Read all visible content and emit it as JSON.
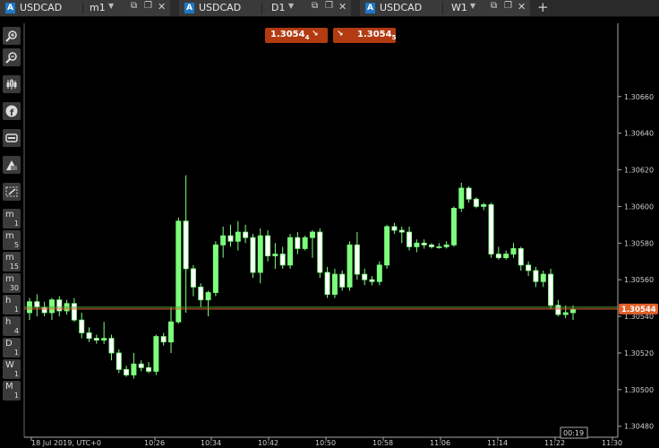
{
  "tabs": [
    {
      "badge": "A",
      "symbol": "USDCAD",
      "timeframe": "m1"
    },
    {
      "badge": "A",
      "symbol": "USDCAD",
      "timeframe": "D1"
    },
    {
      "badge": "A",
      "symbol": "USDCAD",
      "timeframe": "W1"
    }
  ],
  "new_tab_label": "+",
  "toolbar_buttons": [
    "zoom-in-icon",
    "zoom-out-icon",
    "indicators-icon",
    "facebook-icon",
    "gamepad-icon",
    "drawing-icon",
    "screenshot-icon"
  ],
  "timeframes": [
    {
      "unit": "m",
      "num": "1"
    },
    {
      "unit": "m",
      "num": "5"
    },
    {
      "unit": "m",
      "num": "15"
    },
    {
      "unit": "m",
      "num": "30"
    },
    {
      "unit": "h",
      "num": "1"
    },
    {
      "unit": "h",
      "num": "4"
    },
    {
      "unit": "D",
      "num": "1"
    },
    {
      "unit": "W",
      "num": "1"
    },
    {
      "unit": "M",
      "num": "1"
    }
  ],
  "bid": {
    "price": "1.3054",
    "pip": "4"
  },
  "ask": {
    "price": "1.3054",
    "pip": "5"
  },
  "current_price": "1.30544",
  "countdown": "00:19",
  "colors": {
    "bull": "#7dff7d",
    "bear": "#ffffff",
    "price_line": "#e0602a",
    "accent": "#b23b12"
  },
  "chart_data": {
    "type": "candlestick",
    "instrument": "USDCAD",
    "timeframe": "m1",
    "y_ticks": [
      "1.30660",
      "1.30640",
      "1.30620",
      "1.30600",
      "1.30580",
      "1.30560",
      "1.30540",
      "1.30520",
      "1.30500",
      "1.30480"
    ],
    "x_ticks": [
      "18 Jul 2019, UTC+0",
      "10:26",
      "10:34",
      "10:42",
      "10:50",
      "10:58",
      "11:06",
      "11:14",
      "11:22",
      "11:30"
    ],
    "ylim": [
      1.30474,
      1.307
    ],
    "candles": [
      [
        1.30542,
        1.3055,
        1.30538,
        1.30548
      ],
      [
        1.30548,
        1.30552,
        1.3054,
        1.30545
      ],
      [
        1.30545,
        1.30548,
        1.3054,
        1.30542
      ],
      [
        1.30542,
        1.3055,
        1.30538,
        1.30549
      ],
      [
        1.30549,
        1.30551,
        1.3054,
        1.30543
      ],
      [
        1.30543,
        1.30549,
        1.30541,
        1.30547
      ],
      [
        1.30547,
        1.3055,
        1.30537,
        1.30538
      ],
      [
        1.30538,
        1.30542,
        1.30528,
        1.30531
      ],
      [
        1.30531,
        1.30534,
        1.30526,
        1.30528
      ],
      [
        1.30528,
        1.3053,
        1.30525,
        1.30527
      ],
      [
        1.30527,
        1.30537,
        1.30525,
        1.30528
      ],
      [
        1.30528,
        1.3053,
        1.30516,
        1.3052
      ],
      [
        1.3052,
        1.30522,
        1.30509,
        1.30511
      ],
      [
        1.30511,
        1.30513,
        1.30507,
        1.30508
      ],
      [
        1.30508,
        1.3052,
        1.30506,
        1.30514
      ],
      [
        1.30514,
        1.30516,
        1.3051,
        1.30512
      ],
      [
        1.30512,
        1.30515,
        1.30509,
        1.3051
      ],
      [
        1.3051,
        1.3053,
        1.30508,
        1.30529
      ],
      [
        1.30529,
        1.30531,
        1.30524,
        1.30526
      ],
      [
        1.30526,
        1.30545,
        1.3052,
        1.30537
      ],
      [
        1.30537,
        1.30594,
        1.30536,
        1.30592
      ],
      [
        1.30592,
        1.30617,
        1.30542,
        1.30566
      ],
      [
        1.30566,
        1.30568,
        1.30551,
        1.30556
      ],
      [
        1.30556,
        1.30558,
        1.30545,
        1.30549
      ],
      [
        1.30549,
        1.30554,
        1.3054,
        1.30553
      ],
      [
        1.30553,
        1.30581,
        1.30551,
        1.30579
      ],
      [
        1.30579,
        1.30589,
        1.30572,
        1.30584
      ],
      [
        1.30584,
        1.3059,
        1.30578,
        1.30581
      ],
      [
        1.30581,
        1.30592,
        1.30576,
        1.30586
      ],
      [
        1.30586,
        1.3059,
        1.3058,
        1.30583
      ],
      [
        1.30583,
        1.30585,
        1.30561,
        1.30564
      ],
      [
        1.30564,
        1.30588,
        1.30558,
        1.30584
      ],
      [
        1.30584,
        1.30587,
        1.3057,
        1.30573
      ],
      [
        1.30573,
        1.3058,
        1.30566,
        1.30574
      ],
      [
        1.30574,
        1.30578,
        1.30566,
        1.30568
      ],
      [
        1.30568,
        1.30585,
        1.30566,
        1.30583
      ],
      [
        1.30583,
        1.30586,
        1.30574,
        1.30577
      ],
      [
        1.30577,
        1.30584,
        1.30576,
        1.30583
      ],
      [
        1.30583,
        1.30587,
        1.30572,
        1.30586
      ],
      [
        1.30586,
        1.30588,
        1.30561,
        1.30564
      ],
      [
        1.30564,
        1.30567,
        1.3055,
        1.30552
      ],
      [
        1.30552,
        1.30566,
        1.3055,
        1.30563
      ],
      [
        1.30563,
        1.30565,
        1.30554,
        1.30556
      ],
      [
        1.30556,
        1.30581,
        1.30554,
        1.30579
      ],
      [
        1.30579,
        1.30586,
        1.3056,
        1.30563
      ],
      [
        1.30563,
        1.30566,
        1.30557,
        1.3056
      ],
      [
        1.3056,
        1.30562,
        1.30557,
        1.30559
      ],
      [
        1.30559,
        1.3057,
        1.30557,
        1.30568
      ],
      [
        1.30568,
        1.3059,
        1.30566,
        1.30589
      ],
      [
        1.30589,
        1.30591,
        1.30585,
        1.30587
      ],
      [
        1.30587,
        1.30589,
        1.3058,
        1.30586
      ],
      [
        1.30586,
        1.30589,
        1.30576,
        1.30578
      ],
      [
        1.30578,
        1.30582,
        1.30575,
        1.3058
      ],
      [
        1.3058,
        1.30582,
        1.30577,
        1.30579
      ],
      [
        1.30579,
        1.3058,
        1.30577,
        1.30578
      ],
      [
        1.30578,
        1.3058,
        1.30577,
        1.30578
      ],
      [
        1.30578,
        1.30581,
        1.30577,
        1.30579
      ],
      [
        1.30579,
        1.306,
        1.30578,
        1.30599
      ],
      [
        1.30599,
        1.30613,
        1.30597,
        1.3061
      ],
      [
        1.3061,
        1.30611,
        1.30602,
        1.30604
      ],
      [
        1.30604,
        1.30605,
        1.30599,
        1.306
      ],
      [
        1.306,
        1.30602,
        1.30598,
        1.30601
      ],
      [
        1.30601,
        1.30602,
        1.30572,
        1.30574
      ],
      [
        1.30574,
        1.30578,
        1.30571,
        1.30572
      ],
      [
        1.30572,
        1.30576,
        1.30571,
        1.30574
      ],
      [
        1.30574,
        1.3058,
        1.30572,
        1.30577
      ],
      [
        1.30577,
        1.30578,
        1.30565,
        1.30568
      ],
      [
        1.30568,
        1.3057,
        1.30562,
        1.30565
      ],
      [
        1.30565,
        1.30567,
        1.30556,
        1.30559
      ],
      [
        1.30559,
        1.30565,
        1.30556,
        1.30563
      ],
      [
        1.30563,
        1.30566,
        1.30544,
        1.30546
      ],
      [
        1.30546,
        1.30549,
        1.3054,
        1.30541
      ],
      [
        1.30541,
        1.30546,
        1.30539,
        1.30542
      ],
      [
        1.30542,
        1.30546,
        1.30538,
        1.30544
      ]
    ]
  }
}
